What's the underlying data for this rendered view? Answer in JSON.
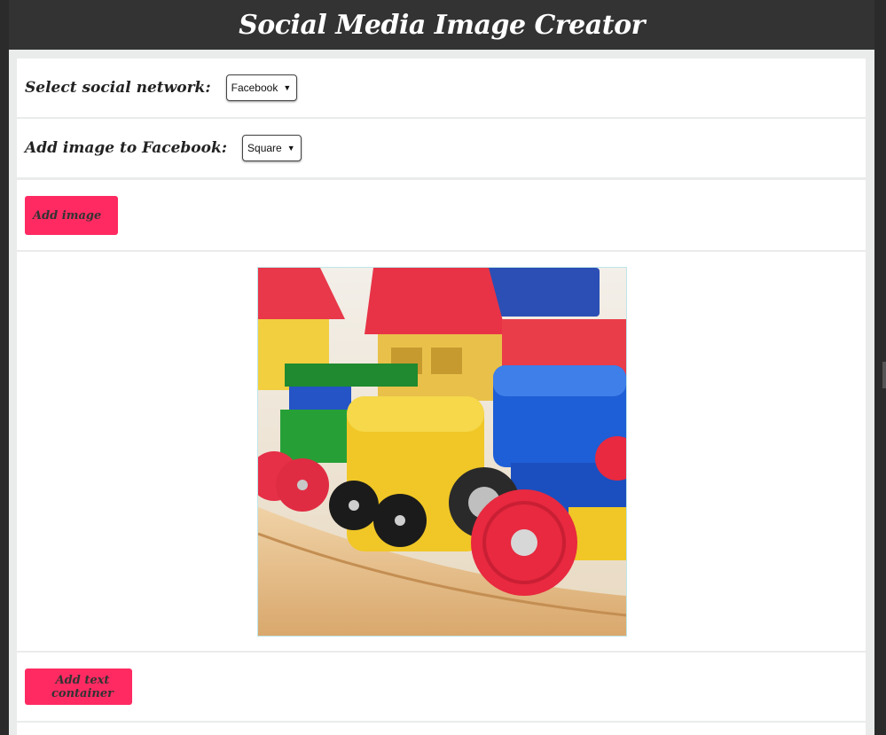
{
  "header": {
    "title": "Social Media Image Creator"
  },
  "network": {
    "label": "Select social network:",
    "selected": "Facebook"
  },
  "image_type": {
    "label": "Add image to Facebook:",
    "selected": "Square"
  },
  "buttons": {
    "add_image": "Add image",
    "add_text_container": "Add text container"
  },
  "icons": {
    "dropdown": "chevron-down-icon"
  },
  "colors": {
    "accent": "#ff2a62",
    "header_bg": "#333333",
    "page_bg": "#2b2b2b"
  }
}
